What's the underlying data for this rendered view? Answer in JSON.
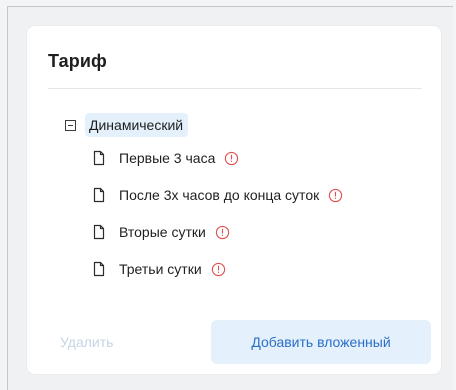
{
  "card": {
    "title": "Тариф"
  },
  "tree": {
    "root": {
      "label": "Динамический",
      "expanded": true
    },
    "children": [
      {
        "label": "Первые 3 часа",
        "warning": true
      },
      {
        "label": "После 3х часов до конца суток",
        "warning": true
      },
      {
        "label": "Вторые сутки",
        "warning": true
      },
      {
        "label": "Третьи сутки",
        "warning": true
      }
    ]
  },
  "actions": {
    "delete_label": "Удалить",
    "delete_enabled": false,
    "add_nested_label": "Добавить вложенный"
  },
  "colors": {
    "selection_bg": "#e4f1fc",
    "warning": "#e05252",
    "primary_text": "#2a6fc9",
    "disabled_text": "#c5d5e6"
  }
}
